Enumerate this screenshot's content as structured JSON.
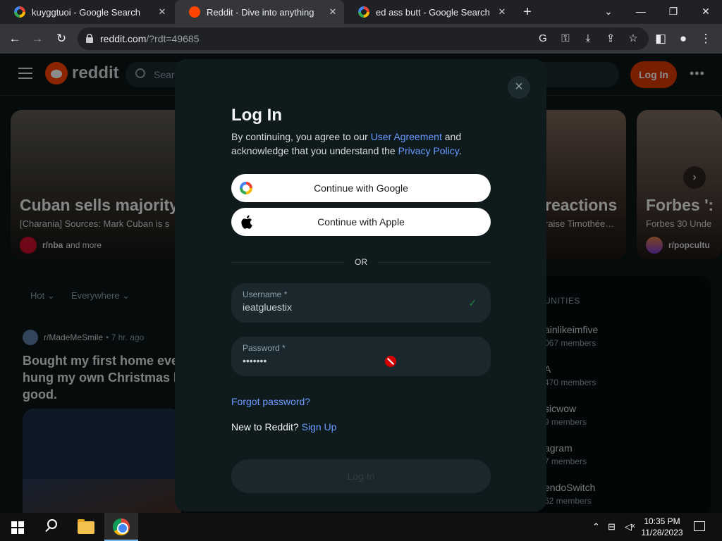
{
  "browser": {
    "tabs": [
      {
        "title": "kuyggtuoi - Google Search",
        "favicon": "google-favicon",
        "active": false
      },
      {
        "title": "Reddit - Dive into anything",
        "favicon": "reddit-favicon",
        "active": true
      },
      {
        "title": "ed ass butt - Google Search",
        "favicon": "google-favicon",
        "active": false
      }
    ],
    "tab_close": "✕",
    "new_tab": "+",
    "window_controls": {
      "dropdown": "⌄",
      "minimize": "—",
      "restore": "❐",
      "close": "✕"
    },
    "nav": {
      "back": "←",
      "forward": "→",
      "reload": "↻"
    },
    "url_host": "reddit.com",
    "url_path": "/?rdt=49685",
    "omnibox_icons": [
      "google-lens-icon",
      "key-icon",
      "install-icon",
      "share-icon",
      "star-icon"
    ],
    "toolbar_icons": [
      "side-panel-icon",
      "profile-icon",
      "menu-icon"
    ]
  },
  "reddit": {
    "logo": "reddit",
    "search_placeholder": "Search Reddit",
    "login_label": "Log In",
    "more": "•••",
    "cards": [
      {
        "title": "Cuban sells majority",
        "sub": "[Charania] Sources: Mark Cuban is s",
        "community": "r/nba",
        "extra": "and more",
        "color": "#3a3328",
        "av": "#c8102e"
      },
      {
        "title": "reactions",
        "sub": "raise Timothée…",
        "community": "",
        "extra": "",
        "color": "#4a3a30",
        "av": "#6b4e3d"
      },
      {
        "title": "Forbes ':",
        "sub": "Forbes 30 Unde",
        "community": "r/popcultu",
        "extra": "",
        "color": "#5a4840",
        "av": "#e07a3a"
      }
    ],
    "feed": {
      "sort": "Hot",
      "scope": "Everywhere",
      "chev": "⌄"
    },
    "post": {
      "community": "r/MadeMeSmile",
      "time": "• 7 hr. ago",
      "title": "Bought my first home eve hung my own Christmas l good."
    },
    "sidebar": {
      "header": "UNITIES",
      "communities": [
        {
          "name": "ainlikeimfive",
          "members": "067 members"
        },
        {
          "name": "A",
          "members": "470 members"
        },
        {
          "name": "sicwow",
          "members": "9 members"
        },
        {
          "name": "agram",
          "members": "7 members"
        },
        {
          "name": "endoSwitch",
          "members": "62 members"
        }
      ]
    }
  },
  "modal": {
    "close": "×",
    "title": "Log In",
    "terms_prefix": "By continuing, you agree to our ",
    "terms_link1": "User Agreement",
    "terms_mid": " and acknowledge that you understand the ",
    "terms_link2": "Privacy Policy",
    "terms_suffix": ".",
    "google_label": "Continue with Google",
    "apple_label": "Continue with Apple",
    "or": "OR",
    "username_label": "Username *",
    "username_value": "ieatgluestix",
    "username_check": "✓",
    "password_label": "Password *",
    "password_value": "•••••••",
    "forgot": "Forgot password?",
    "new_prefix": "New to Reddit? ",
    "signup": "Sign Up",
    "submit": "Log In"
  },
  "taskbar": {
    "time": "10:35 PM",
    "date": "11/28/2023",
    "tray_icons": [
      "chevron-up-icon",
      "network-icon",
      "volume-muted-icon"
    ]
  },
  "colors": {
    "accent": "#ff4500",
    "login_btn": "#d93900",
    "link": "#6a9bff",
    "modal_bg": "#0e1a1c"
  }
}
